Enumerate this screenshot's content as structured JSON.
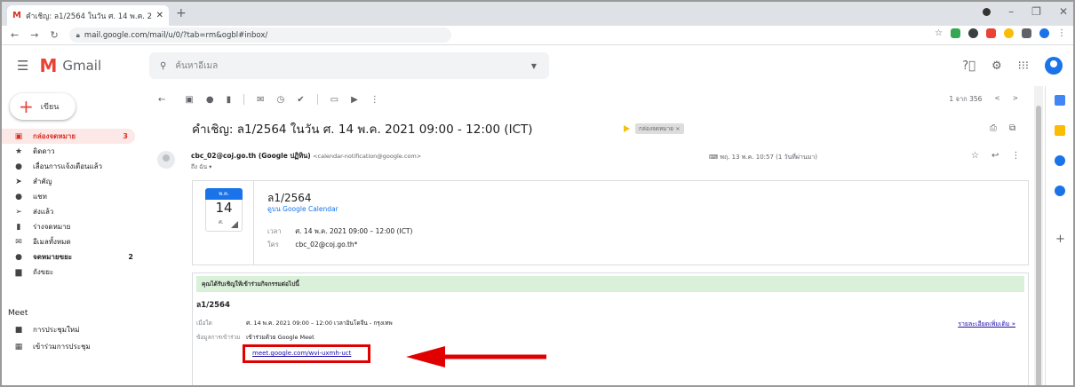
{
  "browser": {
    "tab_title": "คำเชิญ: ล1/2564 ในวัน ศ. 14 พ.ค. 2",
    "tab_favicon": "M",
    "tab_close": "✕",
    "new_tab": "+",
    "url": "mail.google.com/mail/u/0/?tab=rm&ogbl#inbox/"
  },
  "gmail": {
    "brand": "Gmail",
    "search_placeholder": "ค้นหาอีเมล",
    "compose_label": "เขียน"
  },
  "sidebar": {
    "items": [
      {
        "label": "กล่องจดหมาย",
        "count": "3",
        "icon": "inbox-icon",
        "glyph": "▣",
        "active": true
      },
      {
        "label": "ติดดาว",
        "count": "",
        "icon": "star-icon",
        "glyph": "★"
      },
      {
        "label": "เลื่อนการแจ้งเตือนแล้ว",
        "count": "",
        "icon": "clock-icon",
        "glyph": "●"
      },
      {
        "label": "สำคัญ",
        "count": "",
        "icon": "important-icon",
        "glyph": "➤"
      },
      {
        "label": "แชท",
        "count": "",
        "icon": "chat-icon",
        "glyph": "●"
      },
      {
        "label": "ส่งแล้ว",
        "count": "",
        "icon": "send-icon",
        "glyph": "➢"
      },
      {
        "label": "ร่างจดหมาย",
        "count": "",
        "icon": "draft-icon",
        "glyph": "▮"
      },
      {
        "label": "อีเมลทั้งหมด",
        "count": "",
        "icon": "all-mail-icon",
        "glyph": "✉"
      },
      {
        "label": "จดหมายขยะ",
        "count": "2",
        "icon": "spam-icon",
        "glyph": "●",
        "bold": true
      },
      {
        "label": "ถังขยะ",
        "count": "",
        "icon": "trash-icon",
        "glyph": "▆"
      }
    ],
    "meet_header": "Meet",
    "meet_items": [
      {
        "label": "การประชุมใหม่",
        "icon": "video-icon",
        "glyph": "■"
      },
      {
        "label": "เข้าร่วมการประชุม",
        "icon": "keyboard-icon",
        "glyph": "▦"
      }
    ]
  },
  "toolbar": {
    "pager": "1 จาก 356"
  },
  "message": {
    "subject": "คำเชิญ: ล1/2564 ในวัน ศ. 14 พ.ค. 2021 09:00 - 12:00 (ICT)",
    "label_chip": "กล่องจดหมาย ×",
    "sender_name": "cbc_02@coj.go.th (Google ปฏิทิน)",
    "sender_email": "<calendar-notification@google.com>",
    "to_line": "ถึง ฉัน ▾",
    "date_meta": "พฤ. 13 พ.ค. 10:57 (1 วันที่ผ่านมา)"
  },
  "calendar_card": {
    "month": "พ.ค.",
    "day": "14",
    "dow": "ศ.",
    "title": "ล1/2564",
    "view_link": "ดูบน Google Calendar",
    "time_key": "เวลา",
    "time_value": "ศ. 14 พ.ค. 2021 09:00 – 12:00 (ICT)",
    "who_key": "ใคร",
    "who_value": "cbc_02@coj.go.th*"
  },
  "invite": {
    "header": "คุณได้รับเชิญให้เข้าร่วมกิจกรรมต่อไปนี้",
    "event_title": "ล1/2564",
    "when_key": "เมื่อใด",
    "when_value": "ศ. 14 พ.ค. 2021 09:00 – 12:00 เวลาอินโดจีน - กรุงเทพ",
    "join_key": "ข้อมูลการเข้าร่วม",
    "join_value": "เข้าร่วมด้วย Google Meet",
    "meet_link": "meet.google.com/wvi-uxmh-uct",
    "more_details": "รายละเอียดเพิ่มเติม »"
  },
  "colors": {
    "gmail_red": "#ea4335",
    "active_bg": "#fce8e6",
    "link_blue": "#1a0dab",
    "invite_header_green": "#d9f0d9",
    "highlight_red": "#e00000"
  }
}
